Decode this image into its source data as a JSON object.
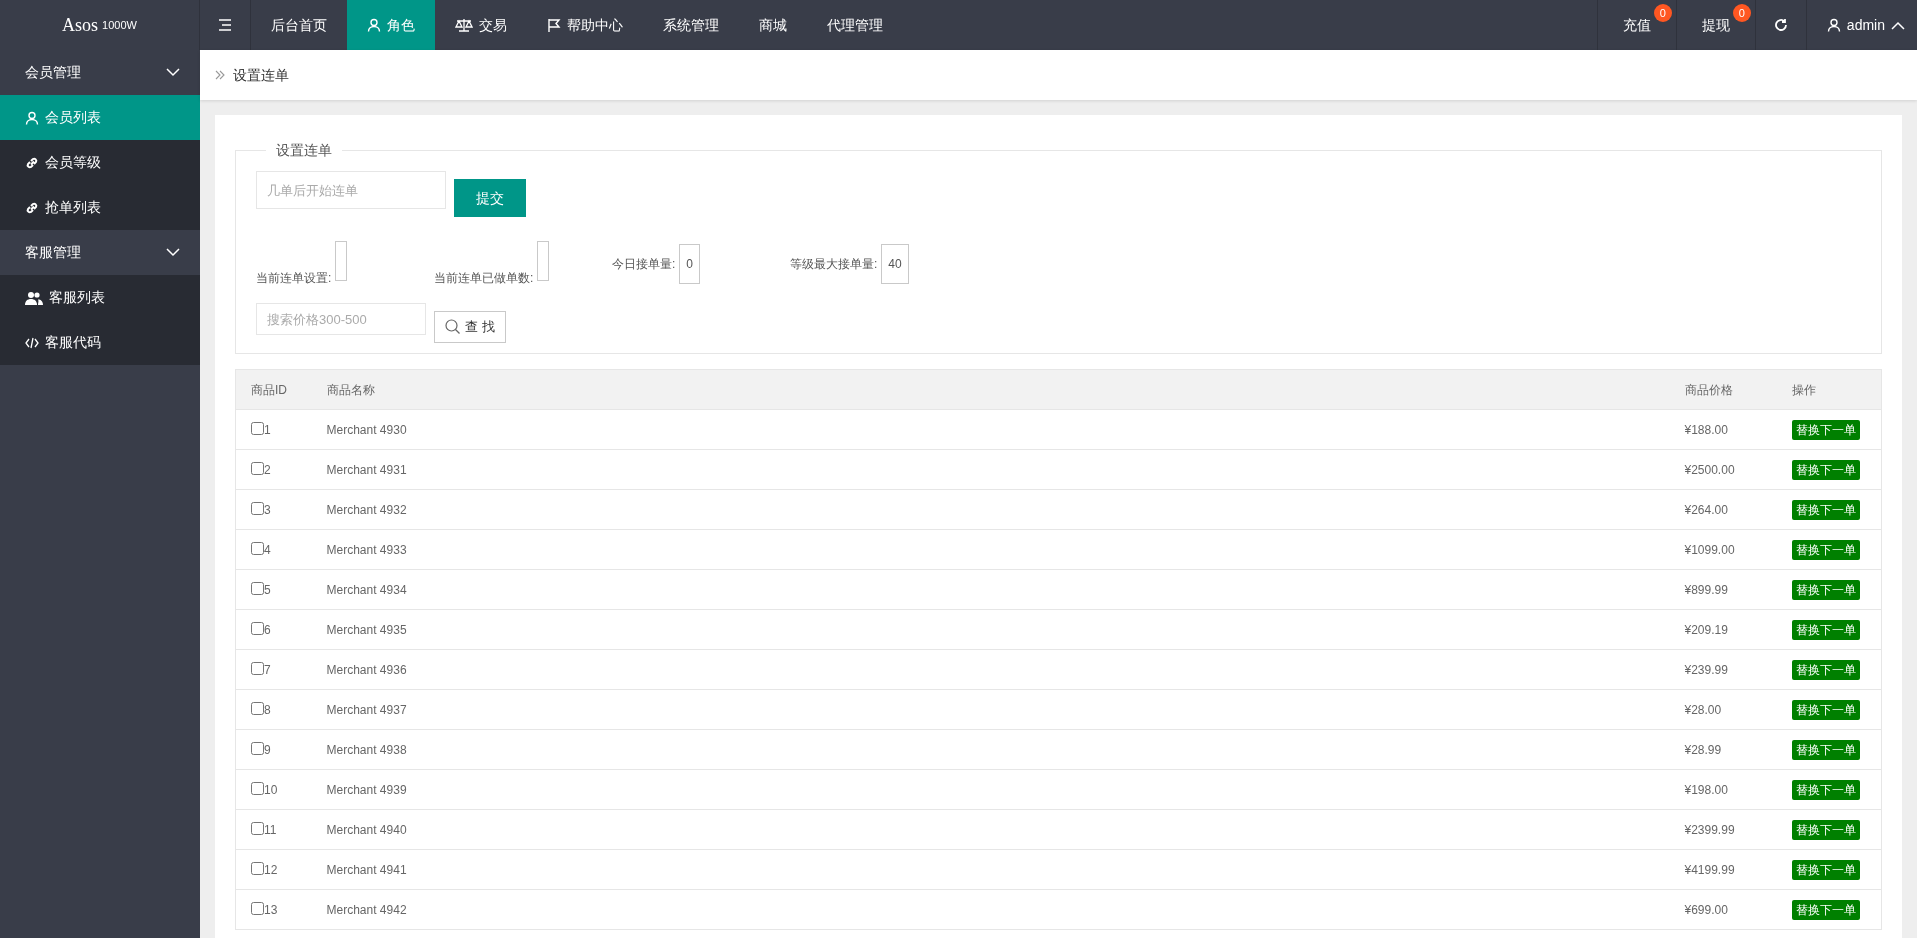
{
  "header": {
    "logo": "Asos",
    "logo_sup": "1000W",
    "nav": [
      {
        "label": "后台首页",
        "selected": false
      },
      {
        "label": "角色",
        "selected": true
      },
      {
        "label": "交易",
        "selected": false
      },
      {
        "label": "帮助中心",
        "selected": false
      },
      {
        "label": "系统管理",
        "selected": false
      },
      {
        "label": "商城",
        "selected": false
      },
      {
        "label": "代理管理",
        "selected": false
      }
    ],
    "right": [
      {
        "label": "充值",
        "badge": "0"
      },
      {
        "label": "提现",
        "badge": "0"
      }
    ],
    "user": "admin",
    "user_menu_expanded": true
  },
  "sidebar": [
    {
      "label": "会员管理",
      "expanded": true,
      "items": [
        {
          "label": "会员列表",
          "selected": true
        },
        {
          "label": "会员等级",
          "selected": false
        },
        {
          "label": "抢单列表",
          "selected": false
        }
      ]
    },
    {
      "label": "客服管理",
      "expanded": true,
      "items": [
        {
          "label": "客服列表",
          "selected": false
        },
        {
          "label": "客服代码",
          "selected": false
        }
      ]
    }
  ],
  "breadcrumb": "设置连单",
  "form": {
    "legend": "设置连单",
    "start_field": {
      "placeholder": "几单后开始连单"
    },
    "submit": "提交",
    "stats": [
      {
        "label": "当前连单设置:"
      },
      {
        "label": "当前连单已做单数:"
      },
      {
        "label": "今日接单量:",
        "value": "0"
      },
      {
        "label": "等级最大接单量:",
        "value": "40"
      }
    ],
    "search_field": {
      "placeholder": "搜索价格300-500"
    },
    "search_button": "查 找"
  },
  "table": {
    "columns": [
      "商品ID",
      "商品名称",
      "商品价格",
      "操作"
    ],
    "rows": [
      {
        "id": "1",
        "name": "Merchant 4930",
        "price": "¥188.00",
        "action": "替换下一单",
        "checked": false
      },
      {
        "id": "2",
        "name": "Merchant 4931",
        "price": "¥2500.00",
        "action": "替换下一单",
        "checked": false
      },
      {
        "id": "3",
        "name": "Merchant 4932",
        "price": "¥264.00",
        "action": "替换下一单",
        "checked": false
      },
      {
        "id": "4",
        "name": "Merchant 4933",
        "price": "¥1099.00",
        "action": "替换下一单",
        "checked": false
      },
      {
        "id": "5",
        "name": "Merchant 4934",
        "price": "¥899.99",
        "action": "替换下一单",
        "checked": false
      },
      {
        "id": "6",
        "name": "Merchant 4935",
        "price": "¥209.19",
        "action": "替换下一单",
        "checked": false
      },
      {
        "id": "7",
        "name": "Merchant 4936",
        "price": "¥239.99",
        "action": "替换下一单",
        "checked": false
      },
      {
        "id": "8",
        "name": "Merchant 4937",
        "price": "¥28.00",
        "action": "替换下一单",
        "checked": false
      },
      {
        "id": "9",
        "name": "Merchant 4938",
        "price": "¥28.99",
        "action": "替换下一单",
        "checked": false
      },
      {
        "id": "10",
        "name": "Merchant 4939",
        "price": "¥198.00",
        "action": "替换下一单",
        "checked": false
      },
      {
        "id": "11",
        "name": "Merchant 4940",
        "price": "¥2399.99",
        "action": "替换下一单",
        "checked": false
      },
      {
        "id": "12",
        "name": "Merchant 4941",
        "price": "¥4199.99",
        "action": "替换下一单",
        "checked": false
      },
      {
        "id": "13",
        "name": "Merchant 4942",
        "price": "¥699.00",
        "action": "替换下一单",
        "checked": false
      }
    ]
  }
}
